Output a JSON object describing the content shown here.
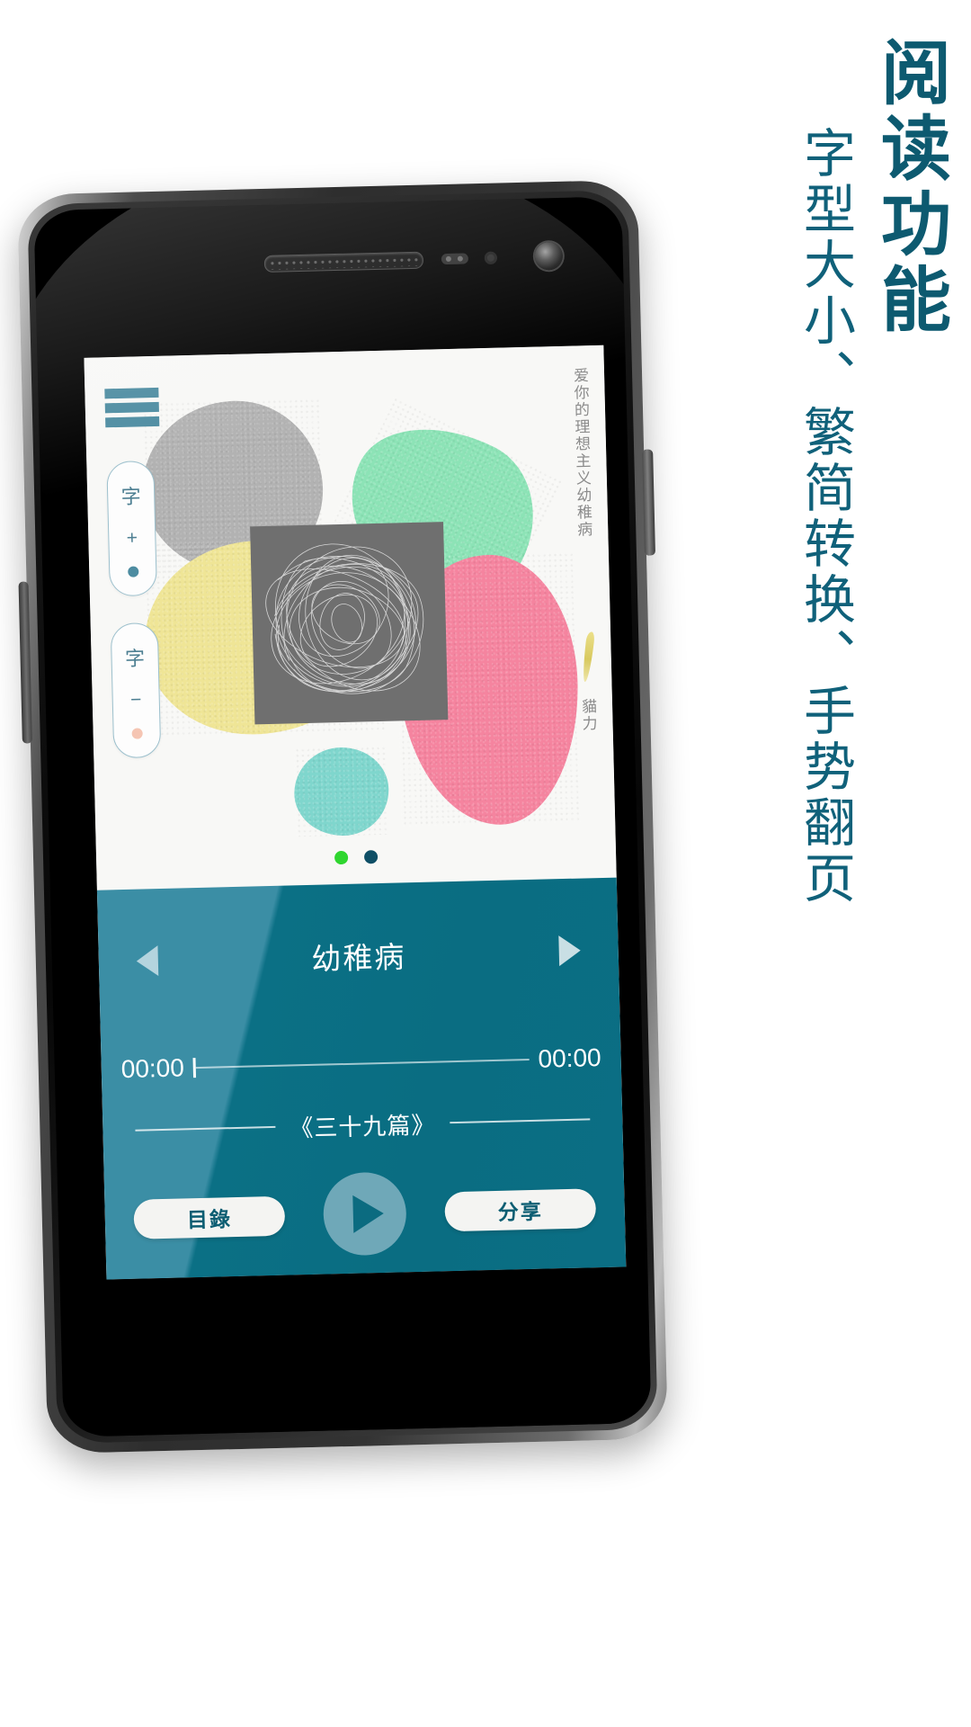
{
  "promo": {
    "headline": "阅读功能",
    "subhead": "字型大小、繁简转换、手势翻页",
    "accent_color": "#0d5a70"
  },
  "device": {
    "name": "android-smartphone-mockup",
    "earpiece": "speaker-grille",
    "front_camera": "front-camera",
    "proximity_sensor": "proximity-sensor",
    "volume_key": "volume-rocker",
    "power_key": "power-button"
  },
  "reader": {
    "menu_icon": "hamburger-menu-icon",
    "article_text": "爱你的理想主义幼稚病",
    "byline": "貓力",
    "brush_mark": "brush-stroke-divider",
    "font_increase": {
      "label": "字",
      "operator": "+",
      "indicator_state": "on",
      "indicator_color": "#4d8ca1"
    },
    "font_decrease": {
      "label": "字",
      "operator": "−",
      "indicator_state": "off",
      "indicator_color": "#f5c5b3"
    },
    "pagination": [
      {
        "state": "active",
        "color": "#2fd62f"
      },
      {
        "state": "inactive",
        "color": "#0f4f66"
      }
    ],
    "artwork": {
      "card": "scribble-artwork-card",
      "blob_colors": [
        "#b2b2b2",
        "#8ce3b6",
        "#efe596",
        "#f5849f",
        "#7fd6cd"
      ]
    }
  },
  "player": {
    "background_color": "#0b7085",
    "prev_icon": "previous-track-icon",
    "next_icon": "next-track-icon",
    "track_title": "幼稚病",
    "elapsed_time": "00:00",
    "total_time": "00:00",
    "chapter_name": "《三十九篇》",
    "catalog_button": "目錄",
    "share_button": "分享",
    "play_icon": "play-icon"
  }
}
